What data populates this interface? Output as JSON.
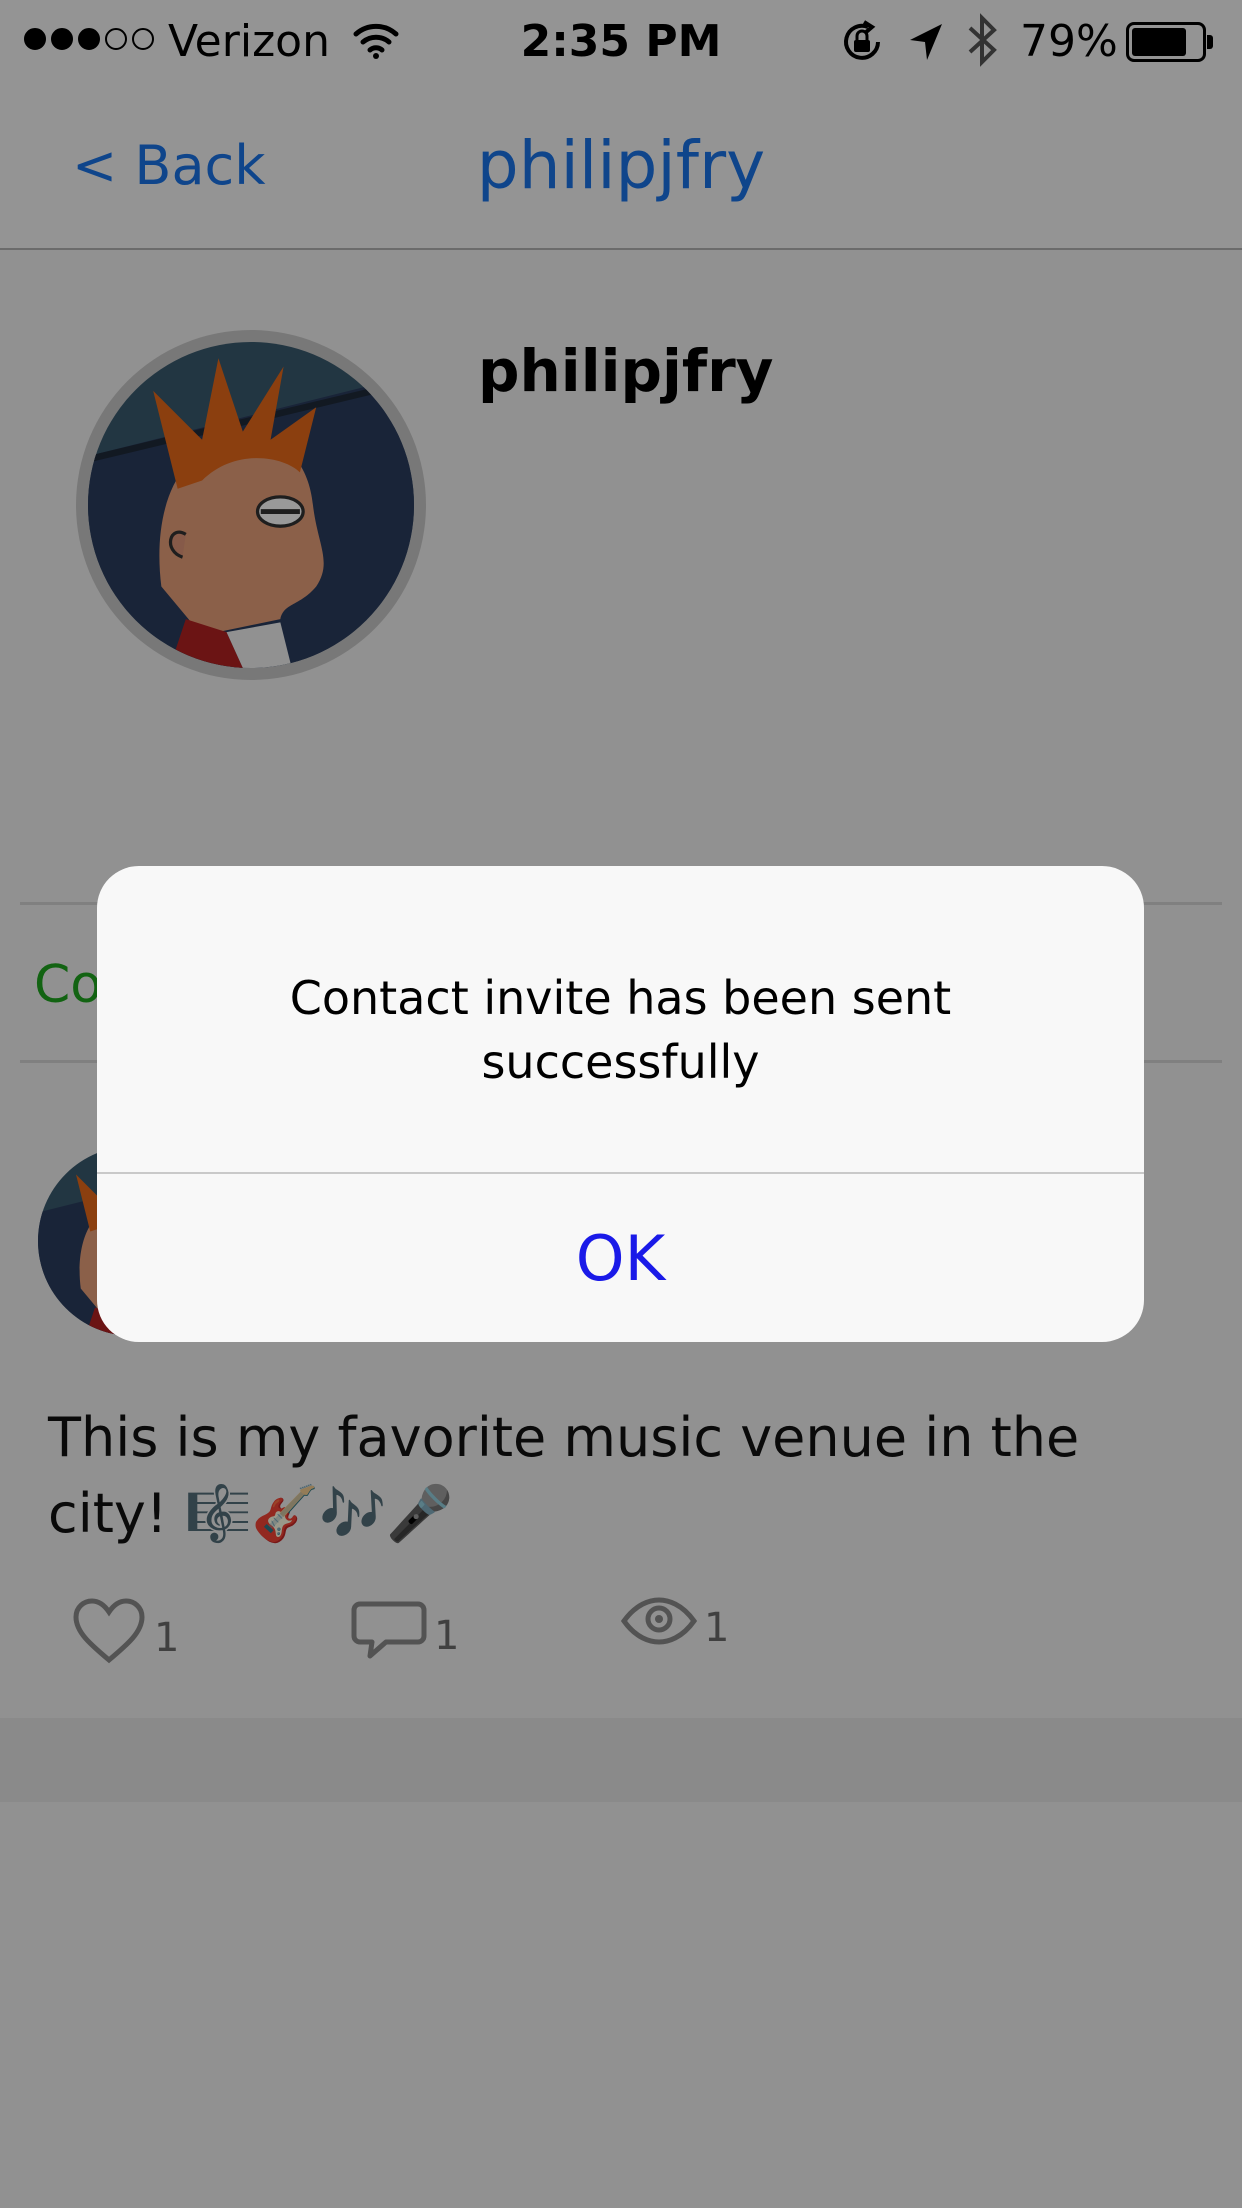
{
  "status_bar": {
    "signal_full": 3,
    "signal_total": 5,
    "carrier": "Verizon",
    "time": "2:35 PM",
    "battery_percent": "79%",
    "battery_level": 0.79
  },
  "nav": {
    "back_label": "< Back",
    "title": "philipjfry"
  },
  "profile": {
    "username": "philipjfry"
  },
  "section": {
    "label_visible": "Co"
  },
  "post": {
    "text": "This is my favorite music venue in the city! 🎼🎸🎶🎤",
    "likes": "1",
    "comments": "1",
    "views": "1"
  },
  "alert": {
    "message": "Contact invite has been sent successfully",
    "ok_label": "OK"
  },
  "colors": {
    "accent_blue": "#1a74e8",
    "alert_button_blue": "#1a1ae8",
    "section_green": "#1ea51e"
  },
  "icons": {
    "wifi": "wifi-icon",
    "orientation_lock": "orientation-lock-icon",
    "location": "location-arrow-icon",
    "bluetooth": "bluetooth-icon",
    "battery": "battery-icon",
    "like": "heart-icon",
    "comment": "comment-bubble-icon",
    "view": "eye-icon"
  }
}
